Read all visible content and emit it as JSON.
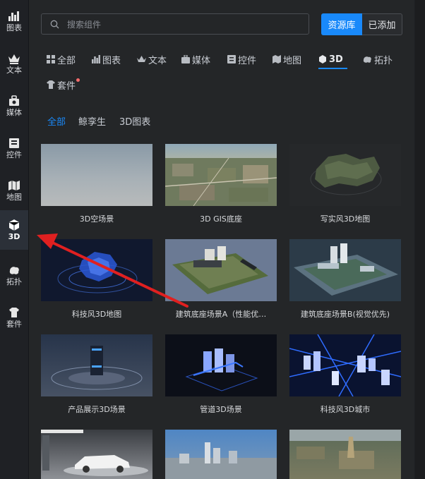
{
  "sidebar": {
    "items": [
      {
        "label": "图表",
        "icon": "chart-icon"
      },
      {
        "label": "文本",
        "icon": "crown-text-icon"
      },
      {
        "label": "媒体",
        "icon": "media-bag-icon"
      },
      {
        "label": "控件",
        "icon": "widget-icon"
      },
      {
        "label": "地图",
        "icon": "map-icon"
      },
      {
        "label": "3D",
        "icon": "cube-icon",
        "active": true
      },
      {
        "label": "拓扑",
        "icon": "topology-icon"
      },
      {
        "label": "套件",
        "icon": "kit-icon"
      }
    ]
  },
  "search": {
    "placeholder": "搜索组件"
  },
  "segment": {
    "library": "资源库",
    "added": "已添加"
  },
  "tabs": [
    "全部",
    "图表",
    "文本",
    "媒体",
    "控件",
    "地图",
    "3D",
    "拓扑",
    "套件"
  ],
  "active_tab": "3D",
  "subtabs": [
    "全部",
    "鲸孪生",
    "3D图表"
  ],
  "active_subtab": "全部",
  "cards": [
    "3D空场景",
    "3D GIS底座",
    "写实风3D地图",
    "科技风3D地图",
    "建筑底座场景A（性能优…",
    "建筑底座场景B(视觉优先)",
    "产品展示3D场景",
    "管道3D场景",
    "科技风3D城市"
  ],
  "colors": {
    "accent": "#1989fa",
    "annotation_arrow": "#e02020",
    "badge": "#f56c6c"
  }
}
